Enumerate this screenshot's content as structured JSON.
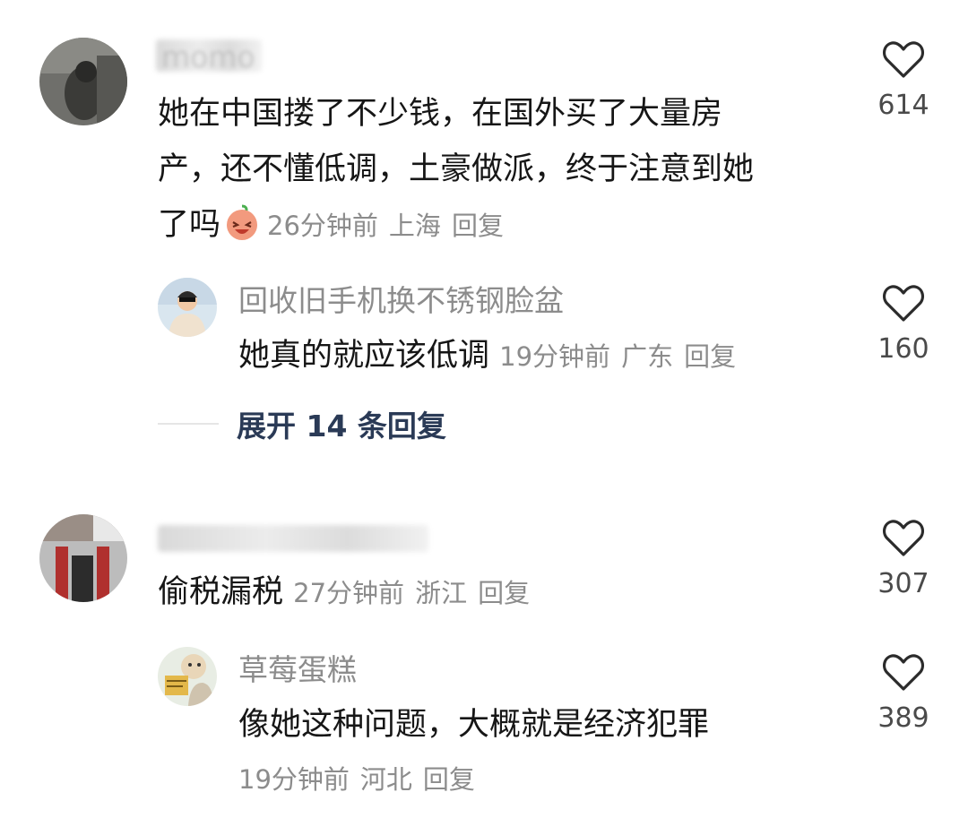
{
  "comments": [
    {
      "author": "momo",
      "text_lines": [
        "她在中国搂了不少钱，在国外买了大量房",
        "产，还不懂低调，土豪做派，终于注意到她",
        "了吗"
      ],
      "emoji": "laughing-face-emoji",
      "time": "26分钟前",
      "location": "上海",
      "reply_label": "回复",
      "likes": "614",
      "replies": [
        {
          "author": "回收旧手机换不锈钢脸盆",
          "text": "她真的就应该低调",
          "time": "19分钟前",
          "location": "广东",
          "reply_label": "回复",
          "likes": "160"
        }
      ],
      "expand_label": "展开 14 条回复"
    },
    {
      "author": "",
      "text": "偷税漏税",
      "time": "27分钟前",
      "location": "浙江",
      "reply_label": "回复",
      "likes": "307",
      "replies": [
        {
          "author": "草莓蛋糕",
          "text": "像她这种问题，大概就是经济犯罪",
          "time": "19分钟前",
          "location": "河北",
          "reply_label": "回复",
          "likes": "389"
        }
      ]
    }
  ],
  "icons": {
    "like": "heart-outline-icon"
  },
  "colors": {
    "meta_gray": "#8c8c8c",
    "expand_blue": "#2a3a56",
    "text": "#161616"
  }
}
